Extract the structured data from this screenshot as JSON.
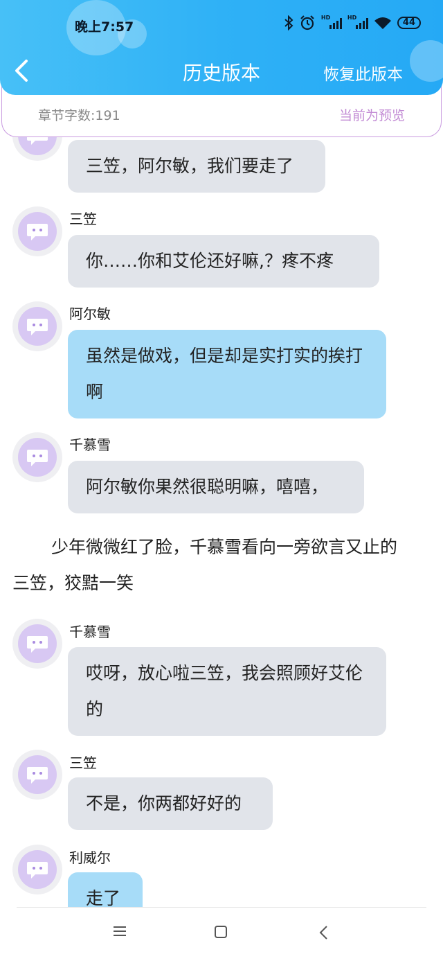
{
  "status_bar": {
    "time": "晚上7:57",
    "battery": "44",
    "hd1": "HD",
    "hd2": "HD"
  },
  "header": {
    "title": "历史版本",
    "action": "恢复此版本"
  },
  "info": {
    "word_count": "章节字数:191",
    "preview_status": "当前为预览"
  },
  "messages": [
    {
      "type": "chat",
      "speaker": "",
      "text": "三笠，阿尔敏，我们要走了",
      "color": "gray"
    },
    {
      "type": "chat",
      "speaker": "三笠",
      "text": "你……你和艾伦还好嘛,？疼不疼",
      "color": "gray"
    },
    {
      "type": "chat",
      "speaker": "阿尔敏",
      "text": "虽然是做戏，但是却是实打实的挨打啊",
      "color": "blue"
    },
    {
      "type": "chat",
      "speaker": "千慕雪",
      "text": "阿尔敏你果然很聪明嘛，嘻嘻，",
      "color": "gray"
    },
    {
      "type": "narration",
      "text": "少年微微红了脸，千慕雪看向一旁欲言又止的三笠，狡黠一笑"
    },
    {
      "type": "chat",
      "speaker": "千慕雪",
      "text": "哎呀，放心啦三笠，我会照顾好艾伦的",
      "color": "gray"
    },
    {
      "type": "chat",
      "speaker": "三笠",
      "text": "不是，你两都好好的",
      "color": "gray"
    },
    {
      "type": "chat",
      "speaker": "利威尔",
      "text": "走了",
      "color": "blue"
    }
  ],
  "colors": {
    "header": "#2fb1f6",
    "bubble_gray": "#e1e4ea",
    "bubble_blue": "#a7dcf8",
    "accent_purple": "#c28ad4",
    "avatar_purple": "#d8c8f3"
  },
  "icons": {
    "back": "chevron-left-icon",
    "nav_menu": "menu-icon",
    "nav_home": "home-icon",
    "nav_back": "back-icon"
  }
}
